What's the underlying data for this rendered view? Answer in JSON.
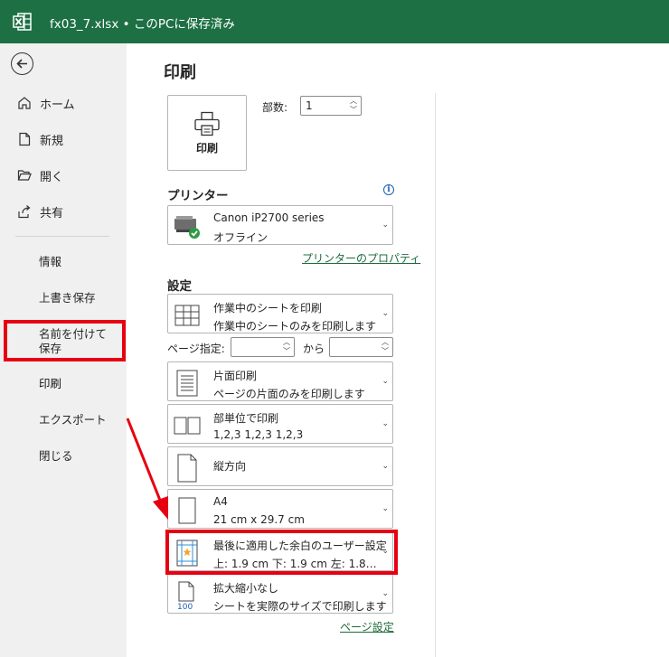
{
  "titlebar": {
    "title": "fx03_7.xlsx • このPCに保存済み"
  },
  "sidebar": {
    "home": "ホーム",
    "new": "新規",
    "open": "開く",
    "share": "共有",
    "info": "情報",
    "save": "上書き保存",
    "save_as": "名前を付けて保存",
    "print": "印刷",
    "export": "エクスポート",
    "close": "閉じる"
  },
  "main": {
    "title": "印刷",
    "print_button": "印刷",
    "copies_label": "部数:",
    "copies_value": "1",
    "printer_heading": "プリンター",
    "printer": {
      "name": "Canon iP2700 series",
      "status": "オフライン"
    },
    "printer_properties": "プリンターのプロパティ",
    "settings_heading": "設定",
    "page_range_label": "ページ指定:",
    "page_range_to": "から",
    "settings": [
      {
        "l1": "作業中のシートを印刷",
        "l2": "作業中のシートのみを印刷します"
      },
      {
        "l1": "片面印刷",
        "l2": "ページの片面のみを印刷します"
      },
      {
        "l1": "部単位で印刷",
        "l2": "1,2,3    1,2,3    1,2,3"
      },
      {
        "l1": "縦方向",
        "l2": ""
      },
      {
        "l1": "A4",
        "l2": "21 cm x 29.7 cm"
      },
      {
        "l1": "最後に適用した余白のユーザー設定",
        "l2": "上: 1.9 cm 下: 1.9 cm 左: 1.8…"
      },
      {
        "l1": "拡大縮小なし",
        "l2": "シートを実際のサイズで印刷します"
      }
    ],
    "page_setup": "ページ設定"
  },
  "colors": {
    "titlebar": "#1d7044",
    "sidebar": "#f0f0f0",
    "highlight": "#e60012",
    "link": "#1d6b3a"
  }
}
